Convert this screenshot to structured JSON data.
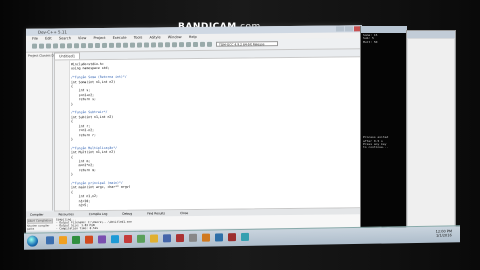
{
  "watermark": {
    "brand": "BANDICAM",
    "suffix": ".com"
  },
  "ide": {
    "title": "Dev-C++ 5.11",
    "menu": [
      "File",
      "Edit",
      "Search",
      "View",
      "Project",
      "Execute",
      "Tools",
      "AStyle",
      "Window",
      "Help"
    ],
    "compiler": "TDM-GCC 4.9.2 64-bit Release",
    "left_tabs": [
      "Project",
      "Classes",
      "Debug"
    ],
    "editor_tab": "Untitled1",
    "code_lines": [
      "#include<stdio.h>",
      "using namespace std;",
      "",
      "/*Função Soma (Retorna int)*/",
      "int Soma(int n1,int n2)",
      "{",
      "    int s;",
      "    s=n1+n2;",
      "    return s;",
      "}",
      "",
      "/*Função Subtrair*/",
      "int Sub(int n1,int n2)",
      "{",
      "    int r;",
      "    r=n1-n2;",
      "    return r;",
      "}",
      "",
      "/*Função Multiplicação*/",
      "int Mult(int n1,int n2)",
      "{",
      "    int m;",
      "    m=n1*n2;",
      "    return m;",
      "}",
      "",
      "/*Função principal (main)*/",
      "int main(int argc, char** argv)",
      "{",
      "    int n1,n2;",
      "    n1=10;",
      "    n2=5;"
    ],
    "bottom_tabs": [
      "Compiler",
      "Resources",
      "Compile Log",
      "Debug",
      "Find Results",
      "Close"
    ],
    "output_left": "Abort Compilation",
    "output_checkbox": "Shorten compiler paths",
    "output_lines": [
      "Compiling...",
      "- Output Filename: C:\\Users\\...\\Untitled1.exe",
      "- Output Size: 1.83 MiB",
      "- Compilation Time: 0.52s"
    ],
    "status": [
      "Line: 1",
      "Col: 1",
      "Sel: 0",
      "Lines: 38",
      "Length: 503",
      "Insert",
      "Done parsing in 0.016 seconds"
    ]
  },
  "console": {
    "lines": [
      "Soma: 15",
      "Sub: 5",
      "Mult: 50",
      "",
      "",
      "",
      "",
      "",
      "",
      "",
      "",
      "",
      "",
      "",
      "",
      "",
      "",
      "",
      "",
      "",
      "",
      "",
      "",
      "",
      "",
      "",
      "",
      "",
      "",
      "",
      "Process exited",
      "after 0.5 s",
      "Press any key",
      "to continue..."
    ]
  },
  "taskbar": {
    "clock_time": "12:00 PM",
    "clock_date": "1/1/2016",
    "icon_colors": [
      "#3b6fb0",
      "#f0a020",
      "#2f8f3f",
      "#d04a20",
      "#7a4fb0",
      "#1e9ad6",
      "#c43c3c",
      "#5aa05a",
      "#e0b030",
      "#4466aa",
      "#aa3333",
      "#888888",
      "#d07a20",
      "#2d6fa8",
      "#9c2f2f",
      "#33a0b0"
    ]
  }
}
